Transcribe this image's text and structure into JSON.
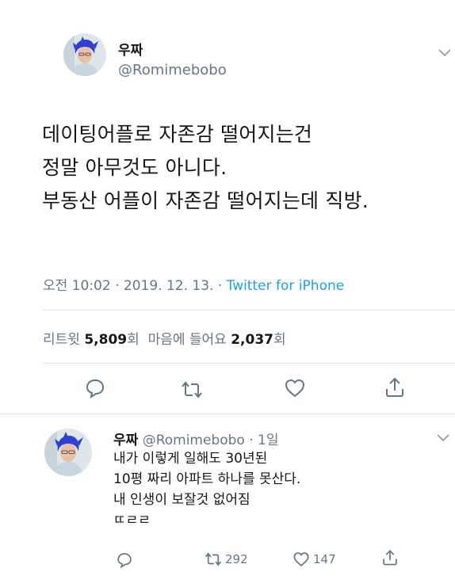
{
  "main_tweet": {
    "display_name": "우짜",
    "handle": "@Romimebobo",
    "text_lines": [
      "데이팅어플로 자존감 떨어지는건",
      "정말 아무것도 아니다.",
      "부동산 어플이 자존감 떨어지는데 직방."
    ],
    "timestamp": "오전 10:02 · 2019. 12. 13. · ",
    "source": "Twitter for iPhone",
    "retweet_label": "리트윗",
    "retweet_count": "5,809",
    "retweet_suffix": "회",
    "like_label": "마음에 들어요",
    "like_count": "2,037",
    "like_suffix": "회",
    "actions": [
      "reply-icon",
      "retweet-icon",
      "like-icon",
      "share-icon"
    ]
  },
  "reply_tweet": {
    "display_name": "우짜",
    "handle": "@Romimebobo · 1일",
    "text_lines": [
      "내가 이렇게 일해도 30년된",
      "10평 짜리 아파트 하나를 못산다.",
      "내 인생이 보잘것 없어짐",
      "ㄸㄹㄹ"
    ],
    "retweet_count": "292",
    "like_count": "147"
  },
  "colors": {
    "text": "#14171a",
    "secondary": "#657786",
    "link": "#1da1f2",
    "divider": "#e1e8ed",
    "avatar_hair": "#2f3fd6"
  }
}
